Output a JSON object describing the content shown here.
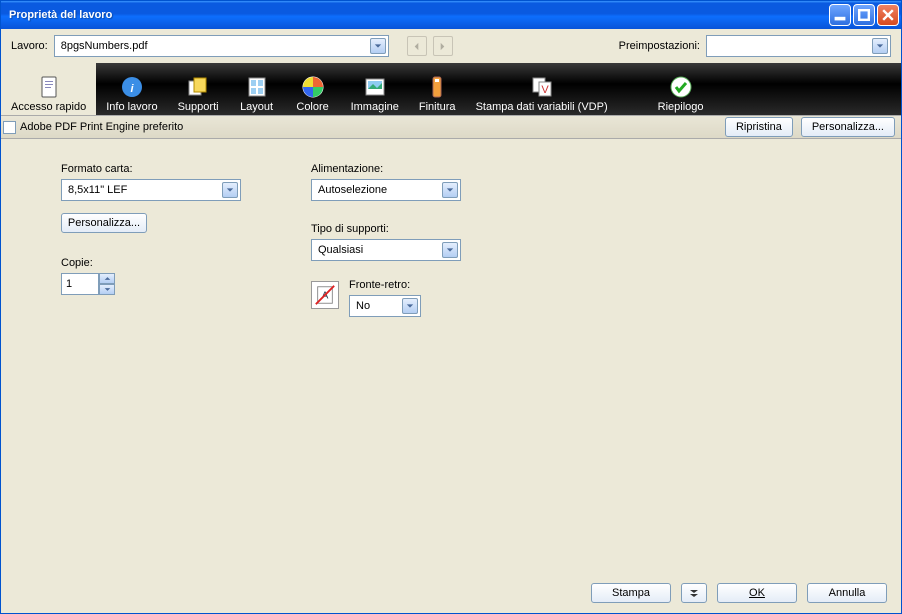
{
  "window": {
    "title": "Proprietà del lavoro"
  },
  "top": {
    "lavoro_label": "Lavoro:",
    "lavoro_value": "8pgsNumbers.pdf",
    "preset_label": "Preimpostazioni:",
    "preset_value": ""
  },
  "tabs": [
    {
      "label": "Accesso rapido"
    },
    {
      "label": "Info lavoro"
    },
    {
      "label": "Supporti"
    },
    {
      "label": "Layout"
    },
    {
      "label": "Colore"
    },
    {
      "label": "Immagine"
    },
    {
      "label": "Finitura"
    },
    {
      "label": "Stampa dati variabili (VDP)"
    },
    {
      "label": "Riepilogo"
    }
  ],
  "subheader": {
    "adobe_pref": "Adobe PDF Print Engine preferito",
    "ripristina": "Ripristina",
    "personalizza": "Personalizza..."
  },
  "form": {
    "formato_label": "Formato carta:",
    "formato_value": "8,5x11\" LEF",
    "personalizza_btn": "Personalizza...",
    "copie_label": "Copie:",
    "copie_value": "1",
    "alim_label": "Alimentazione:",
    "alim_value": "Autoselezione",
    "tipo_label": "Tipo di supporti:",
    "tipo_value": "Qualsiasi",
    "fronte_label": "Fronte-retro:",
    "fronte_value": "No"
  },
  "footer": {
    "stampa": "Stampa",
    "ok": "OK",
    "annulla": "Annulla"
  }
}
